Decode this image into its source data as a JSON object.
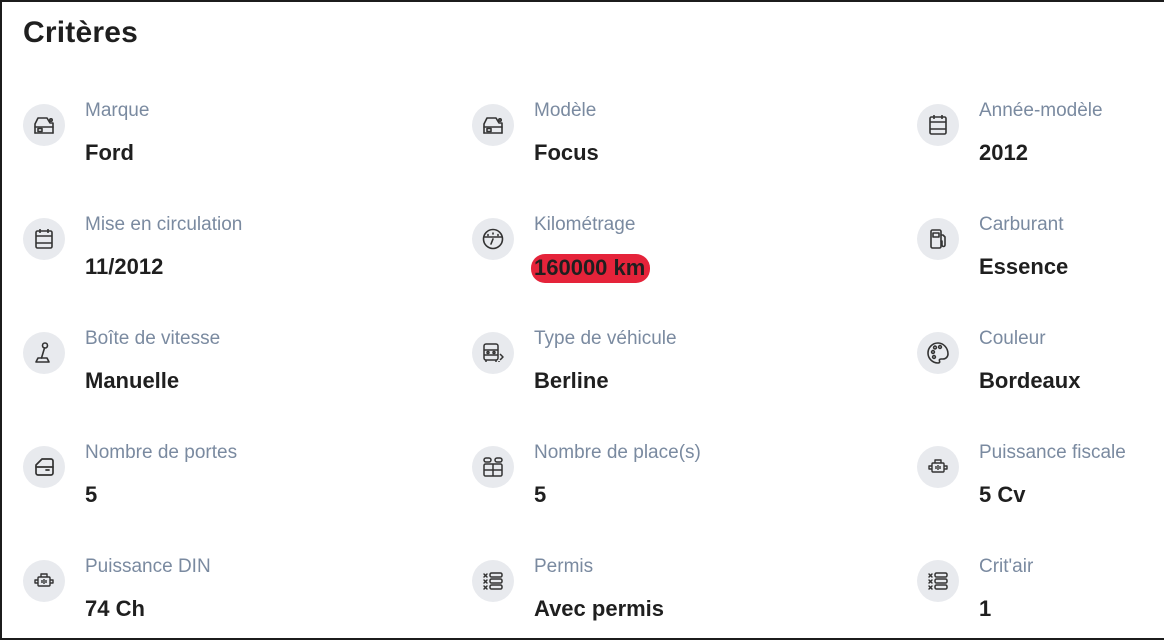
{
  "title": "Critères",
  "criteria": [
    {
      "icon": "car-icon",
      "label": "Marque",
      "value": "Ford"
    },
    {
      "icon": "car-icon",
      "label": "Modèle",
      "value": "Focus"
    },
    {
      "icon": "calendar-icon",
      "label": "Année-modèle",
      "value": "2012"
    },
    {
      "icon": "calendar-icon",
      "label": "Mise en circulation",
      "value": "11/2012"
    },
    {
      "icon": "speedometer-icon",
      "label": "Kilométrage",
      "value": "160000 km"
    },
    {
      "icon": "fuel-pump-icon",
      "label": "Carburant",
      "value": "Essence"
    },
    {
      "icon": "gear-shift-icon",
      "label": "Boîte de vitesse",
      "value": "Manuelle"
    },
    {
      "icon": "vehicle-type-icon",
      "label": "Type de véhicule",
      "value": "Berline"
    },
    {
      "icon": "color-palette-icon",
      "label": "Couleur",
      "value": "Bordeaux"
    },
    {
      "icon": "car-door-icon",
      "label": "Nombre de portes",
      "value": "5"
    },
    {
      "icon": "car-seats-icon",
      "label": "Nombre de place(s)",
      "value": "5"
    },
    {
      "icon": "engine-icon",
      "label": "Puissance fiscale",
      "value": "5 Cv"
    },
    {
      "icon": "engine-icon",
      "label": "Puissance DIN",
      "value": "74 Ch"
    },
    {
      "icon": "license-icon",
      "label": "Permis",
      "value": "Avec permis"
    },
    {
      "icon": "license-icon",
      "label": "Crit'air",
      "value": "1"
    }
  ],
  "colors": {
    "highlight": "#e5233a",
    "label": "#7a8aa0",
    "icon_bg": "#e8eaee"
  }
}
